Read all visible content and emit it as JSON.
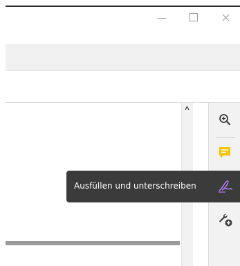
{
  "window": {
    "minimize_glyph": "—",
    "maximize_glyph": "☐",
    "close_glyph": "✕"
  },
  "scrollbar": {
    "up_glyph": "^"
  },
  "right_panel": {
    "tools": [
      {
        "name": "zoom-in-icon",
        "color": "#3a3a3a"
      },
      {
        "name": "comment-icon",
        "color": "#f5c400"
      },
      {
        "name": "fill-and-sign-icon",
        "color": "#a66cf0"
      },
      {
        "name": "wrench-add-icon",
        "color": "#3a3a3a"
      }
    ]
  },
  "tooltip": {
    "text": "Ausfüllen und unterschreiben"
  },
  "colors": {
    "tooltip_bg": "#3b3b3b",
    "panel_bg": "#f2f2f2",
    "accent_purple": "#a66cf0",
    "accent_yellow": "#f5c400"
  }
}
